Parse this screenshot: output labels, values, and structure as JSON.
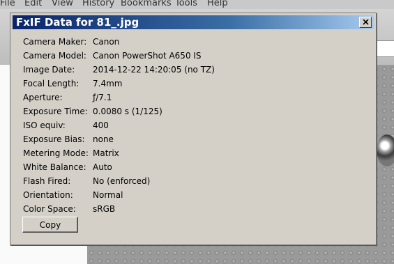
{
  "menu": [
    "File",
    "Edit",
    "View",
    "History",
    "Bookmarks",
    "Tools",
    "Help"
  ],
  "dialog": {
    "title": "FxIF Data for 81_.jpg",
    "copy_label": "Copy",
    "fields": [
      {
        "label": "Camera Maker:",
        "value": "Canon"
      },
      {
        "label": "Camera Model:",
        "value": "Canon PowerShot A650 IS"
      },
      {
        "label": "Image Date:",
        "value": "2014-12-22 14:20:05 (no TZ)"
      },
      {
        "label": "Focal Length:",
        "value": "7.4mm"
      },
      {
        "label": "Aperture:",
        "value": "ƒ/7.1"
      },
      {
        "label": "Exposure Time:",
        "value": "0.0080 s (1/125)"
      },
      {
        "label": "ISO equiv:",
        "value": "400"
      },
      {
        "label": "Exposure Bias:",
        "value": "none"
      },
      {
        "label": "Metering Mode:",
        "value": "Matrix"
      },
      {
        "label": "White Balance:",
        "value": "Auto"
      },
      {
        "label": "Flash Fired:",
        "value": "No (enforced)"
      },
      {
        "label": "Orientation:",
        "value": "Normal"
      },
      {
        "label": "Color Space:",
        "value": "sRGB"
      }
    ]
  },
  "icons": {
    "close": "close-icon"
  },
  "colors": {
    "titlebar_start": "#0a246a",
    "dialog_bg": "#d4d0c8"
  }
}
